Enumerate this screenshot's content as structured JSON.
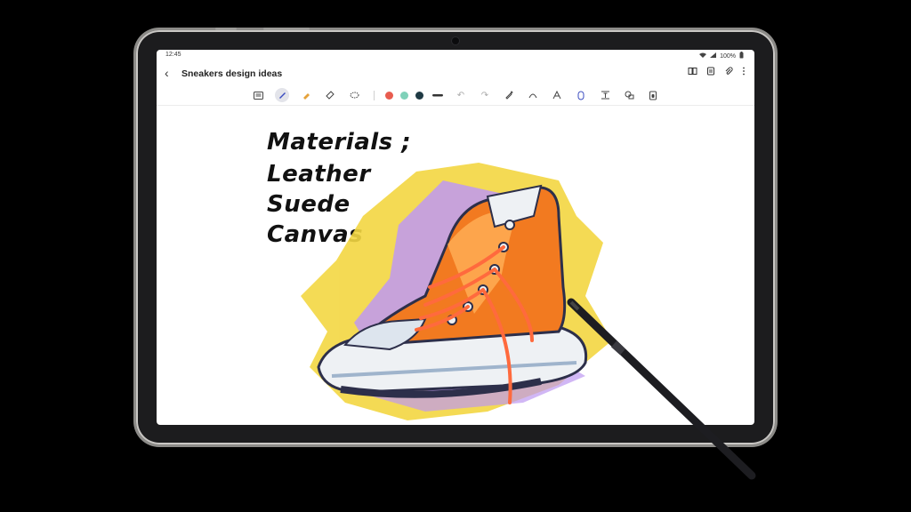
{
  "status": {
    "time": "12:45",
    "battery": "100%"
  },
  "note": {
    "title": "Sneakers design ideas",
    "handwriting": [
      "Materials ;",
      "Leather",
      "Suede",
      "Canvas"
    ]
  },
  "toolbar_icons": {
    "back": "back-arrow-icon",
    "right": [
      "book-icon",
      "page-icon",
      "attach-icon",
      "more-icon"
    ],
    "drawing": [
      "keyboard-icon",
      "pen-icon",
      "highlighter-icon",
      "eraser-icon",
      "lasso-icon",
      "undo-icon",
      "redo-icon",
      "pen-settings-icon",
      "shape-icon",
      "handwriting-text-icon",
      "spen-icon",
      "text-box-icon",
      "image-icon",
      "voice-icon"
    ]
  },
  "colors": {
    "swatches": [
      "#e85c4f",
      "#7fd1b9",
      "#1f3a44"
    ],
    "stroke": "#333333",
    "active_tool_bg": "#e3e4ea"
  }
}
